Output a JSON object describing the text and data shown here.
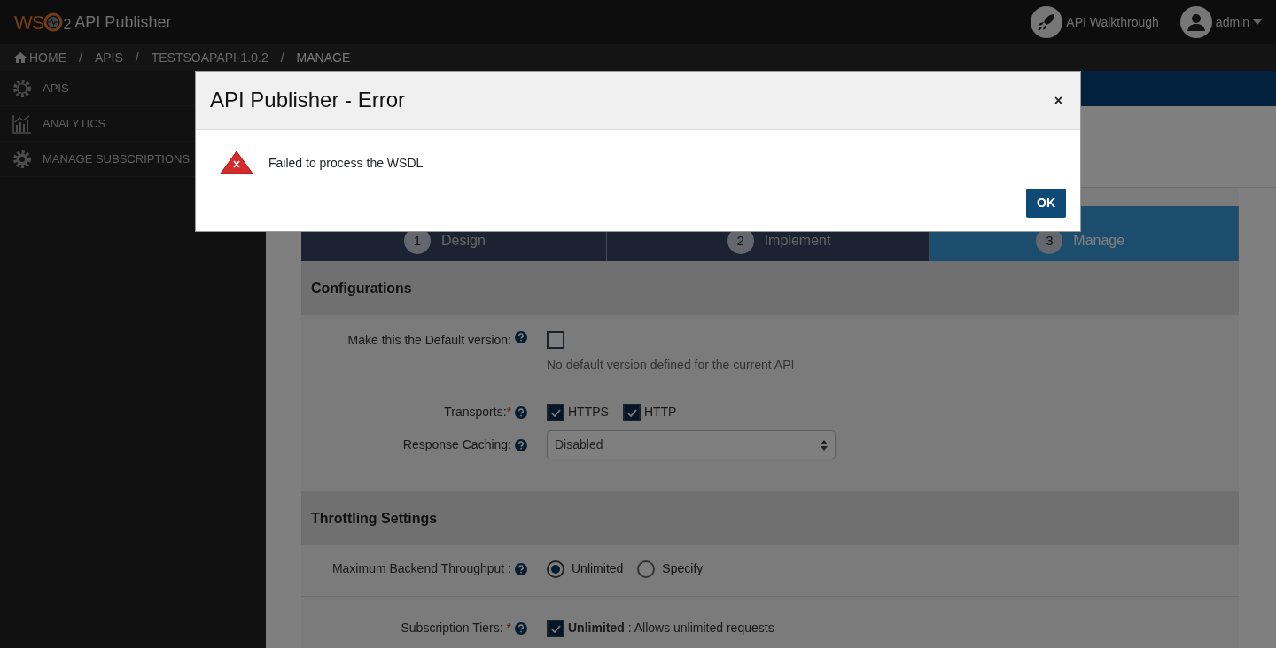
{
  "app": {
    "logo_text": "WS",
    "logo_sub": "2",
    "title": "API Publisher"
  },
  "header_actions": [
    {
      "kind": "walkthrough",
      "label": "API Walkthrough"
    },
    {
      "kind": "user",
      "label": "admin"
    }
  ],
  "breadcrumb": {
    "separator": "/",
    "items": [
      "HOME",
      "APIS",
      "TESTSOAPAPI-1.0.2",
      "MANAGE"
    ]
  },
  "sidebar": {
    "items": [
      {
        "kind": "apis",
        "label": "APIS"
      },
      {
        "kind": "analytics",
        "label": "ANALYTICS"
      },
      {
        "kind": "settings",
        "label": "MANAGE SUBSCRIPTIONS"
      }
    ]
  },
  "wizard": [
    {
      "number": "1",
      "label": "Design",
      "selected": false
    },
    {
      "number": "2",
      "label": "Implement",
      "selected": false
    },
    {
      "number": "3",
      "label": "Manage",
      "selected": true
    }
  ],
  "sections": [
    {
      "title": "Configurations",
      "rows": [
        {
          "kind": "checkbox",
          "label": "Make this the Default version:",
          "checked": false,
          "hint": "No default version defined for the current API"
        },
        {
          "kind": "checks",
          "label": "Transports:",
          "required_mark": "*",
          "options": [
            {
              "label": "HTTPS",
              "checked": true
            },
            {
              "label": "HTTP",
              "checked": true
            }
          ]
        },
        {
          "kind": "select",
          "label": "Response Caching:",
          "value": "Disabled"
        }
      ]
    },
    {
      "title": "Throttling Settings",
      "rows": [
        {
          "kind": "radios",
          "label": "Maximum Backend Throughput :",
          "options": [
            {
              "label": "Unlimited",
              "selected": true
            },
            {
              "label": "Specify",
              "selected": false
            }
          ]
        },
        {
          "kind": "checks",
          "label": "Subscription Tiers:",
          "required_mark": " *",
          "options": [
            {
              "label": "**Unlimited** : Allows unlimited requests",
              "checked": true
            }
          ]
        }
      ]
    }
  ],
  "modal": {
    "title": "API Publisher - Error",
    "close": "×",
    "message": "Failed to process the WSDL",
    "buttons": [
      "OK"
    ]
  }
}
